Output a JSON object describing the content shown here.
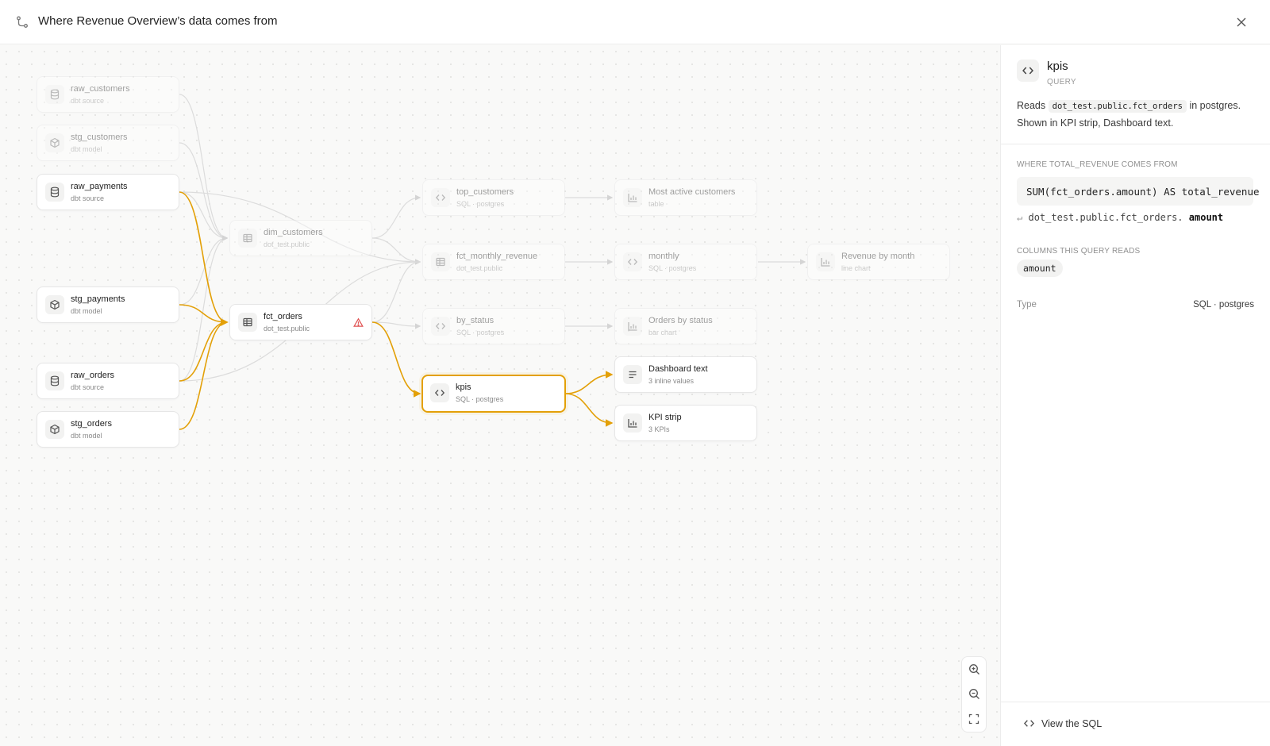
{
  "header": {
    "title": "Where Revenue Overview’s data comes from",
    "icon": "lineage-icon",
    "close_icon": "close-icon"
  },
  "colors": {
    "accent": "#e3a008",
    "warning": "#e05252",
    "dim_edge": "#d6d6d6"
  },
  "nodes": {
    "raw_customers": {
      "name": "raw_customers",
      "sub": "dbt source",
      "icon": "database-icon"
    },
    "stg_customers": {
      "name": "stg_customers",
      "sub": "dbt model",
      "icon": "cube-icon"
    },
    "raw_payments": {
      "name": "raw_payments",
      "sub": "dbt source",
      "icon": "database-icon"
    },
    "stg_payments": {
      "name": "stg_payments",
      "sub": "dbt model",
      "icon": "cube-icon"
    },
    "raw_orders": {
      "name": "raw_orders",
      "sub": "dbt source",
      "icon": "database-icon"
    },
    "stg_orders": {
      "name": "stg_orders",
      "sub": "dbt model",
      "icon": "cube-icon"
    },
    "dim_customers": {
      "name": "dim_customers",
      "sub": "dot_test.public",
      "icon": "table-icon"
    },
    "fct_orders": {
      "name": "fct_orders",
      "sub": "dot_test.public",
      "icon": "table-icon",
      "warning_icon": "warning-icon"
    },
    "top_customers": {
      "name": "top_customers",
      "sub": "SQL · postgres",
      "icon": "code-icon"
    },
    "fct_monthly_revenue": {
      "name": "fct_monthly_revenue",
      "sub": "dot_test.public",
      "icon": "table-icon"
    },
    "by_status": {
      "name": "by_status",
      "sub": "SQL · postgres",
      "icon": "code-icon"
    },
    "kpis": {
      "name": "kpis",
      "sub": "SQL · postgres",
      "icon": "code-icon"
    },
    "most_active": {
      "name": "Most active customers",
      "sub": "table",
      "icon": "bar-chart-icon"
    },
    "monthly": {
      "name": "monthly",
      "sub": "SQL · postgres",
      "icon": "code-icon"
    },
    "orders_by_status": {
      "name": "Orders by status",
      "sub": "bar chart",
      "icon": "bar-chart-icon"
    },
    "dashboard_text": {
      "name": "Dashboard text",
      "sub": "3 inline values",
      "icon": "text-lines-icon"
    },
    "kpi_strip": {
      "name": "KPI strip",
      "sub": "3 KPIs",
      "icon": "bar-chart-icon"
    },
    "revenue_by_month": {
      "name": "Revenue by month",
      "sub": "line chart",
      "icon": "bar-chart-icon"
    }
  },
  "zoom": {
    "zoom_in_icon": "zoom-in-icon",
    "zoom_out_icon": "zoom-out-icon",
    "fit_icon": "fit-view-icon"
  },
  "panel": {
    "name": "kpis",
    "type": "QUERY",
    "desc_prefix": "Reads",
    "desc_table": "dot_test.public.fct_orders",
    "desc_suffix": "in postgres.",
    "desc_line2": "Shown in KPI strip, Dashboard text.",
    "section_origin": "WHERE TOTAL_REVENUE COMES FROM",
    "expression": "SUM(fct_orders.amount) AS total_revenue",
    "source_prefix": "dot_test.public.fct_orders.",
    "source_column": "amount",
    "section_columns": "COLUMNS THIS QUERY READS",
    "columns": [
      "amount"
    ],
    "type_label": "Type",
    "type_value": "SQL · postgres",
    "view_sql": "View the SQL"
  }
}
